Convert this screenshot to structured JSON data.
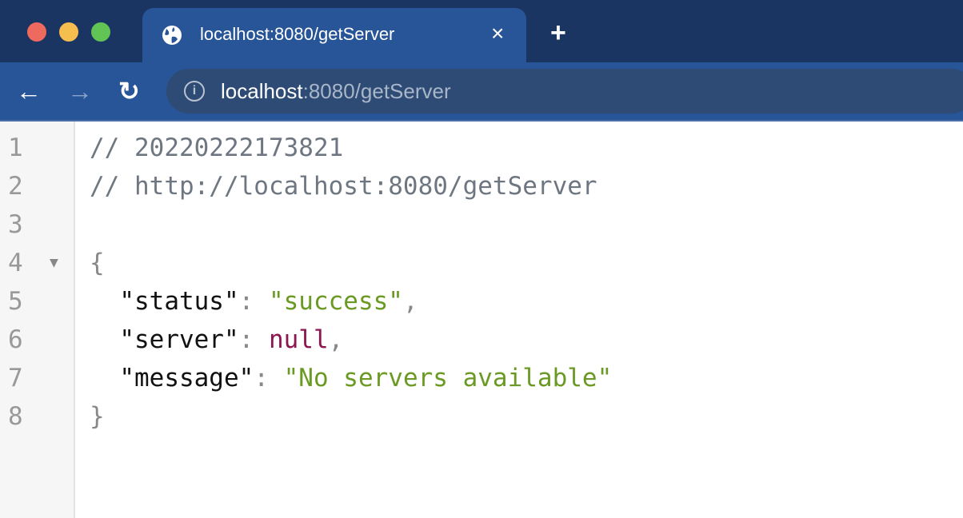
{
  "window": {
    "traffic_lights": {
      "close": "#ee6a5f",
      "minimize": "#f5be4f",
      "maximize": "#61c454"
    }
  },
  "tab": {
    "title": "localhost:8080/getServer",
    "icon": "globe-icon",
    "close_label": "×"
  },
  "new_tab_label": "+",
  "toolbar": {
    "back": "←",
    "forward": "→",
    "reload": "↻"
  },
  "address": {
    "host": "localhost",
    "rest": ":8080/getServer"
  },
  "code": {
    "line_numbers": [
      "1",
      "2",
      "3",
      "4",
      "5",
      "6",
      "7",
      "8"
    ],
    "comment1": "// 20220222173821",
    "comment2": "// http://localhost:8080/getServer",
    "open_brace": "{",
    "close_brace": "}",
    "entries": [
      {
        "key": "\"status\"",
        "value": "\"success\"",
        "type": "string",
        "comma": ","
      },
      {
        "key": "\"server\"",
        "value": "null",
        "type": "null",
        "comma": ","
      },
      {
        "key": "\"message\"",
        "value": "\"No servers available\"",
        "type": "string",
        "comma": ""
      }
    ]
  },
  "colors": {
    "string": "#6a9a23",
    "null": "#8b1650",
    "comment": "#6e7781"
  }
}
